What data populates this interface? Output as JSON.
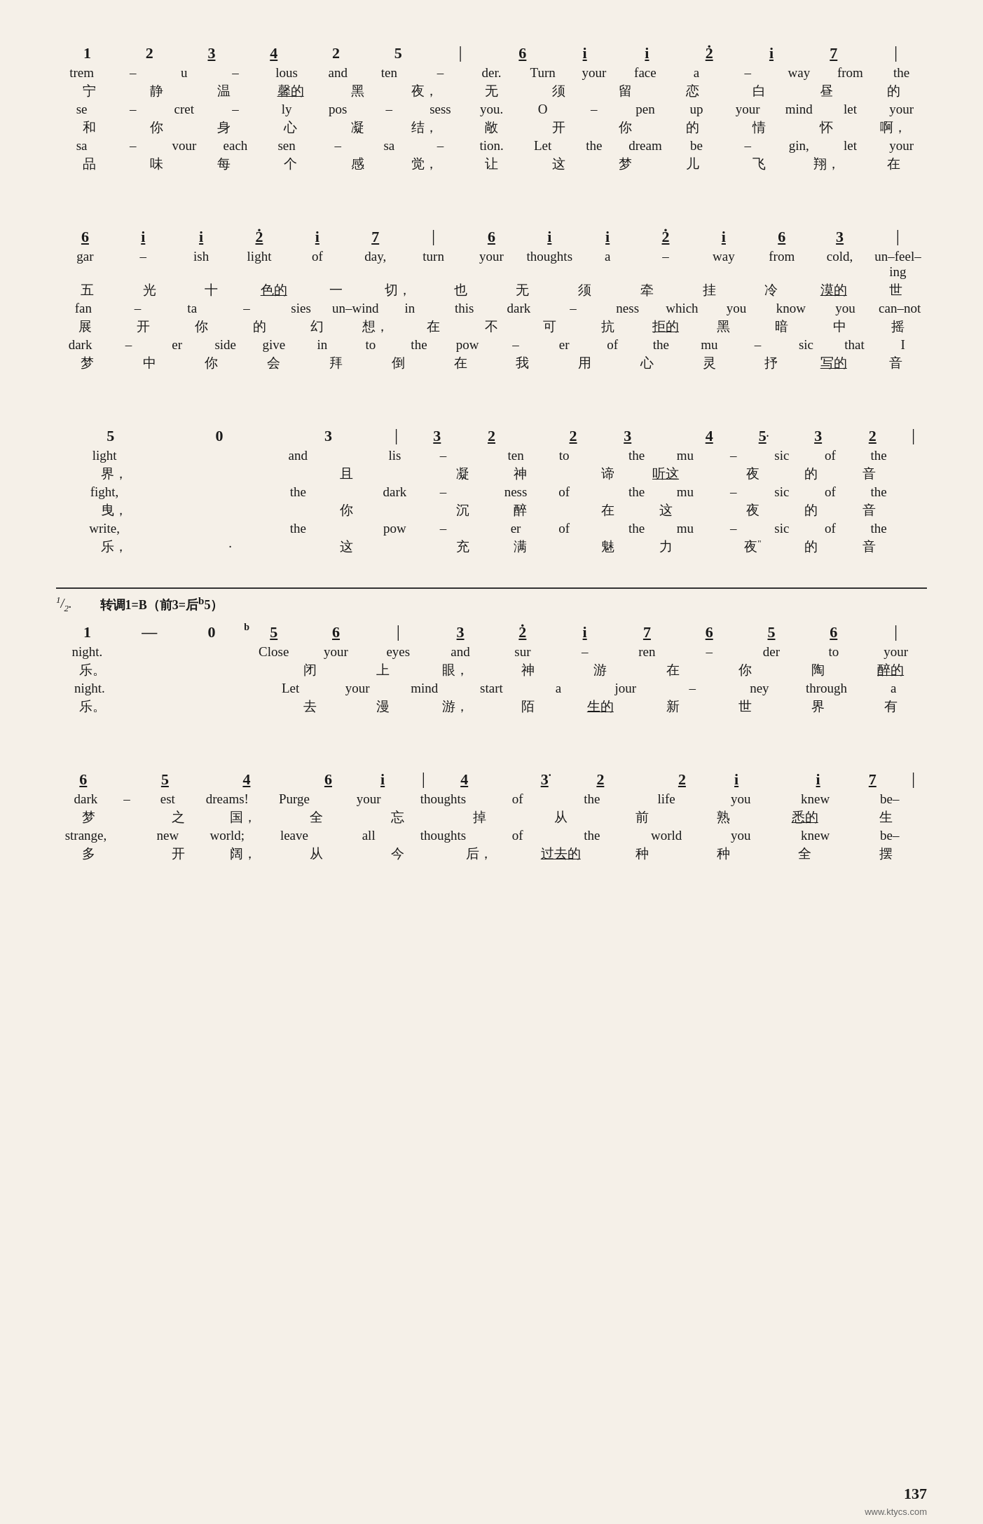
{
  "page": {
    "number": "137",
    "watermark": "www.ktycs.com",
    "sections": [
      {
        "id": "section1",
        "notes": [
          "1",
          "2",
          "3̲",
          "4̲",
          "2",
          "5",
          "|",
          "6̲",
          "i̲",
          "i̲",
          "2̲̇",
          "i̲",
          "7̲",
          "|"
        ],
        "lyrics_rows": [
          "trem – u – lous and ten – der. Turn your face a – way from the",
          "宁 静 温 馨的 黑 夜， 无 须 留 恋 白 昼 的",
          "se – cret – ly pos – sess you. O – pen up your mind let your",
          "和 你 身 心 凝 结， 敞 开 你 的 情 怀 啊，",
          "sa – vour each sen – sa – tion. Let the dream be – gin， let your",
          "品 味 每 个 感 觉， 让 这 梦 儿 飞 翔， 在"
        ]
      },
      {
        "id": "section2",
        "notes": [
          "6̲",
          "i̲",
          "i̲",
          "2̲̇",
          "i̲",
          "7̲",
          "|",
          "6̲",
          "i̲",
          "i̲",
          "2̲̇",
          "i̲",
          "6̲",
          "3̲",
          "|"
        ],
        "lyrics_rows": [
          "gar – ish light of day,  turn your thoughts a – way from cold, un–feel–ing",
          "五 光 十 色的 一 切， 也 无 须 牵 挂 冷 漠的 世",
          "fan – ta – sies un–wind in this dark – ness which you know you can–not",
          "展 开 你 的 幻 想， 在 不 可 抗 拒的 黑 暗 中 摇",
          "dark – er side give in  to the pow – er of the mu – sic that I",
          "梦 中 你 会 拜 倒 在 我 用 心 灵 抒 写的 音"
        ]
      },
      {
        "id": "section3",
        "notes_left": [
          "5",
          "0",
          "3",
          "|"
        ],
        "notes_right": [
          "3̲",
          "2̲",
          "2̲",
          "3̲",
          "4̲",
          "5̣̲",
          "3̲",
          "2̲",
          "|"
        ],
        "lyrics_rows": [
          "light      and lis – ten  to  the  mu – sic of the",
          "界，         且 凝 神 谛 听这 夜 的 音",
          "fight,      the dark – ness of  the  mu – sic of the",
          "曳，         你 沉 醉 在 这 夜 的 音",
          "write,      the pow – er  of  the  mu – sic of the",
          "乐，          这 充 满 魅 力 夜 的 音"
        ]
      },
      {
        "id": "section4_header",
        "repeat_label": "1. 2.",
        "key_change": "转调1=B（前3=后ᵇ5）"
      },
      {
        "id": "section4",
        "notes": [
          "1",
          "—",
          "0",
          "ᵇ5̲",
          "6̲",
          "|",
          "3̲",
          "2̲̇",
          "i̲",
          "7̲",
          "6̲",
          "5̲",
          "6̲",
          "|"
        ],
        "lyrics_rows": [
          "night.          Close your eyes  and sur – ren – der to your",
          "乐。            闭 上 眼， 神 游 在 你 陶 醉的",
          "night.          Let your mind start  a jour – ney through a",
          "乐。            去 漫 游， 陌 生的 新 世 界 有"
        ]
      },
      {
        "id": "section5",
        "notes": [
          "6̲",
          "5̲",
          "4̲",
          "6̲",
          "i̲",
          "|",
          "4̲",
          "3̣̲",
          "2̲",
          "2̲",
          "i̲",
          "i̲",
          "7̲",
          "|"
        ],
        "lyrics_rows": [
          "dark – est dreams! Purge your thoughts of the life you knew be–",
          "梦 之 国， 全 忘 掉  从 前 熟 悉的 生",
          "strange, new world; leave all thoughts of the world you knew be–",
          "多 开 阔， 从 今 后，  过 去的 种 种 全 摆"
        ]
      }
    ]
  }
}
